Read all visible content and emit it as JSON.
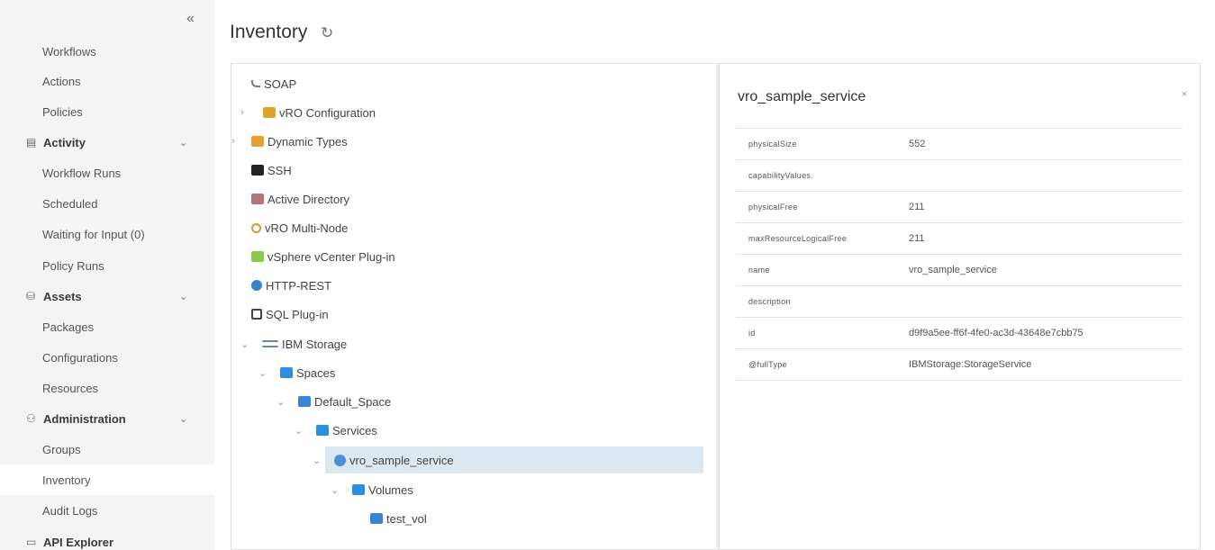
{
  "sidebar": {
    "collapse_icon": "«",
    "items": [
      {
        "label": "Workflows",
        "type": "sub"
      },
      {
        "label": "Actions",
        "type": "sub"
      },
      {
        "label": "Policies",
        "type": "sub"
      },
      {
        "label": "Activity",
        "type": "group",
        "icon": "activity-icon"
      },
      {
        "label": "Workflow Runs",
        "type": "sub"
      },
      {
        "label": "Scheduled",
        "type": "sub"
      },
      {
        "label": "Waiting for Input (0)",
        "type": "sub"
      },
      {
        "label": "Policy Runs",
        "type": "sub"
      },
      {
        "label": "Assets",
        "type": "group",
        "icon": "assets-icon"
      },
      {
        "label": "Packages",
        "type": "sub"
      },
      {
        "label": "Configurations",
        "type": "sub"
      },
      {
        "label": "Resources",
        "type": "sub"
      },
      {
        "label": "Administration",
        "type": "group",
        "icon": "administration-icon"
      },
      {
        "label": "Groups",
        "type": "sub"
      },
      {
        "label": "Inventory",
        "type": "sub",
        "active": true
      },
      {
        "label": "Audit Logs",
        "type": "sub"
      },
      {
        "label": "API Explorer",
        "type": "group",
        "icon": "api-explorer-icon"
      }
    ]
  },
  "main": {
    "title": "Inventory",
    "refresh_icon": "refresh-icon"
  },
  "tree": {
    "nodes": [
      {
        "label": "SOAP",
        "icon": "soap"
      },
      {
        "label": "vRO Configuration",
        "icon": "config",
        "chevron": "›"
      },
      {
        "label": "Dynamic Types",
        "icon": "dyn",
        "chevron": "›"
      },
      {
        "label": "SSH",
        "icon": "ssh"
      },
      {
        "label": "Active Directory",
        "icon": "ad"
      },
      {
        "label": "vRO Multi-Node",
        "icon": "vro"
      },
      {
        "label": "vSphere vCenter Plug-in",
        "icon": "vsphere"
      },
      {
        "label": "HTTP-REST",
        "icon": "http"
      },
      {
        "label": "SQL Plug-in",
        "icon": "sql"
      },
      {
        "label": "IBM Storage",
        "icon": "ibm",
        "chevron": "⌄"
      },
      {
        "label": "Spaces",
        "icon": "folder",
        "chevron": "⌄"
      },
      {
        "label": "Default_Space",
        "icon": "file",
        "chevron": "⌄"
      },
      {
        "label": "Services",
        "icon": "folder",
        "chevron": "⌄"
      },
      {
        "label": "vro_sample_service",
        "icon": "service",
        "chevron": "⌄",
        "selected": true
      },
      {
        "label": "Volumes",
        "icon": "folder",
        "chevron": "⌄"
      },
      {
        "label": "test_vol",
        "icon": "file"
      }
    ]
  },
  "detail": {
    "title": "vro_sample_service",
    "close_icon": "×",
    "properties": [
      {
        "key": "physicalSize",
        "value": "552"
      },
      {
        "key": "capabilityValues",
        "value": ""
      },
      {
        "key": "physicalFree",
        "value": "211"
      },
      {
        "key": "maxResourceLogicalFree",
        "value": "211"
      },
      {
        "key": "name",
        "value": "vro_sample_service"
      },
      {
        "key": "description",
        "value": ""
      },
      {
        "key": "id",
        "value": "d9f9a5ee-ff6f-4fe0-ac3d-43648e7cbb75"
      },
      {
        "key": "@fullType",
        "value": "IBMStorage:StorageService"
      }
    ]
  }
}
